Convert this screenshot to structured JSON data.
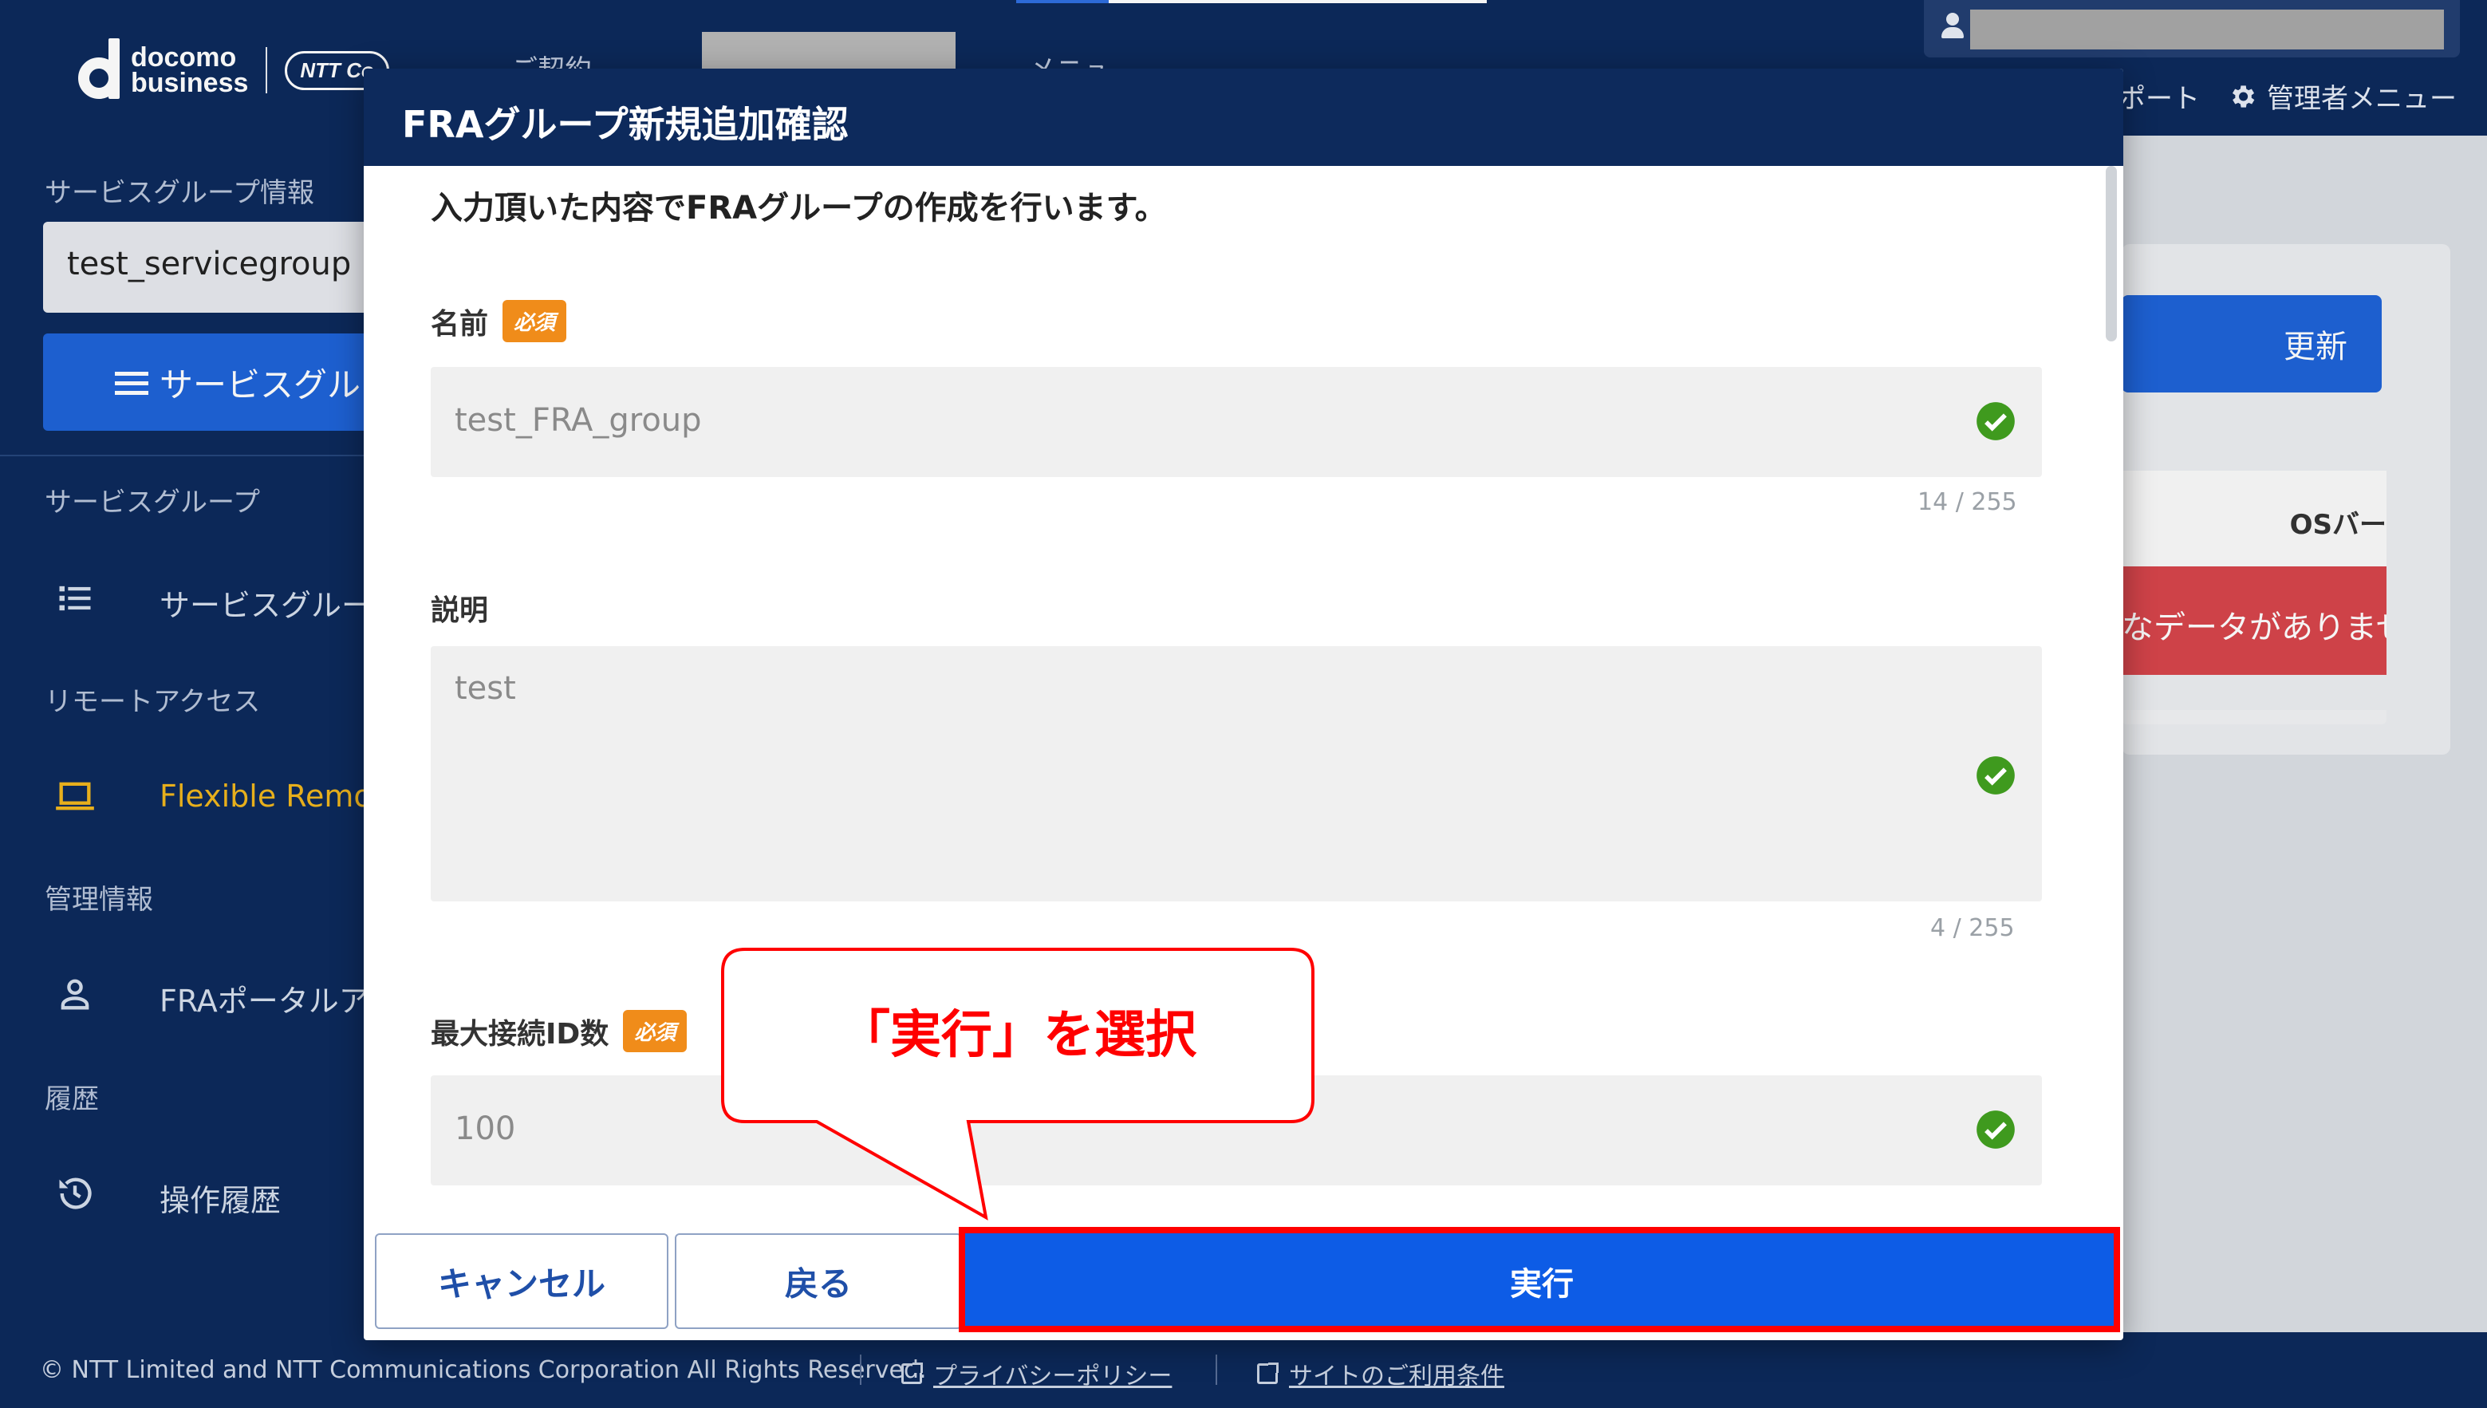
{
  "colors": {
    "navy": "#0d2a5c",
    "primary_blue": "#0d5ce6",
    "sidebar_button_blue": "#1f63d8",
    "required_orange": "#f08c1a",
    "valid_green": "#3f9a1e",
    "annotation_red": "#ff0000",
    "active_yellow": "#f1b71e",
    "error_red": "#d7454b"
  },
  "header": {
    "logo_line1": "docomo",
    "logo_line2": "business",
    "logo_ntt": "NTT Co",
    "nav_fragment_1": "ご契約",
    "nav_fragment_2": "メニュ",
    "support_fragment": "ポート",
    "admin_menu": "管理者メニュー"
  },
  "sidebar": {
    "service_group_info_label": "サービスグループ情報",
    "selected_service_group": "test_servicegroup",
    "service_group_button": "サービスグル",
    "sections": [
      {
        "label": "サービスグループ",
        "item": "サービスグルー",
        "icon": "list-icon"
      },
      {
        "label": "リモートアクセス",
        "item": "Flexible Remote",
        "icon": "laptop-icon",
        "active": true
      },
      {
        "label": "管理情報",
        "item": "FRAポータルアカ",
        "icon": "person-icon"
      },
      {
        "label": "履歴",
        "item": "操作履歴",
        "icon": "history-icon"
      }
    ]
  },
  "content": {
    "update_button": "更新",
    "os_column_header": "OSバー",
    "no_data_message": "なデータがありませ"
  },
  "modal": {
    "title": "FRAグループ新規追加確認",
    "intro": "入力頂いた内容でFRAグループの作成を行います。",
    "required_badge": "必須",
    "fields": {
      "name": {
        "label": "名前",
        "value": "test_FRA_group",
        "counter": "14 / 255",
        "valid": true
      },
      "description": {
        "label": "説明",
        "value": "test",
        "counter": "4 / 255",
        "valid": true
      },
      "max_connections": {
        "label": "最大接続ID数",
        "value": "100",
        "valid": true
      }
    },
    "buttons": {
      "cancel": "キャンセル",
      "back": "戻る",
      "execute": "実行"
    }
  },
  "annotation": {
    "callout_text": "「実行」を選択"
  },
  "footer": {
    "copyright": "© NTT Limited and NTT Communications Corporation All Rights Reserved.",
    "privacy_link": "プライバシーポリシー",
    "terms_link": "サイトのご利用条件"
  }
}
